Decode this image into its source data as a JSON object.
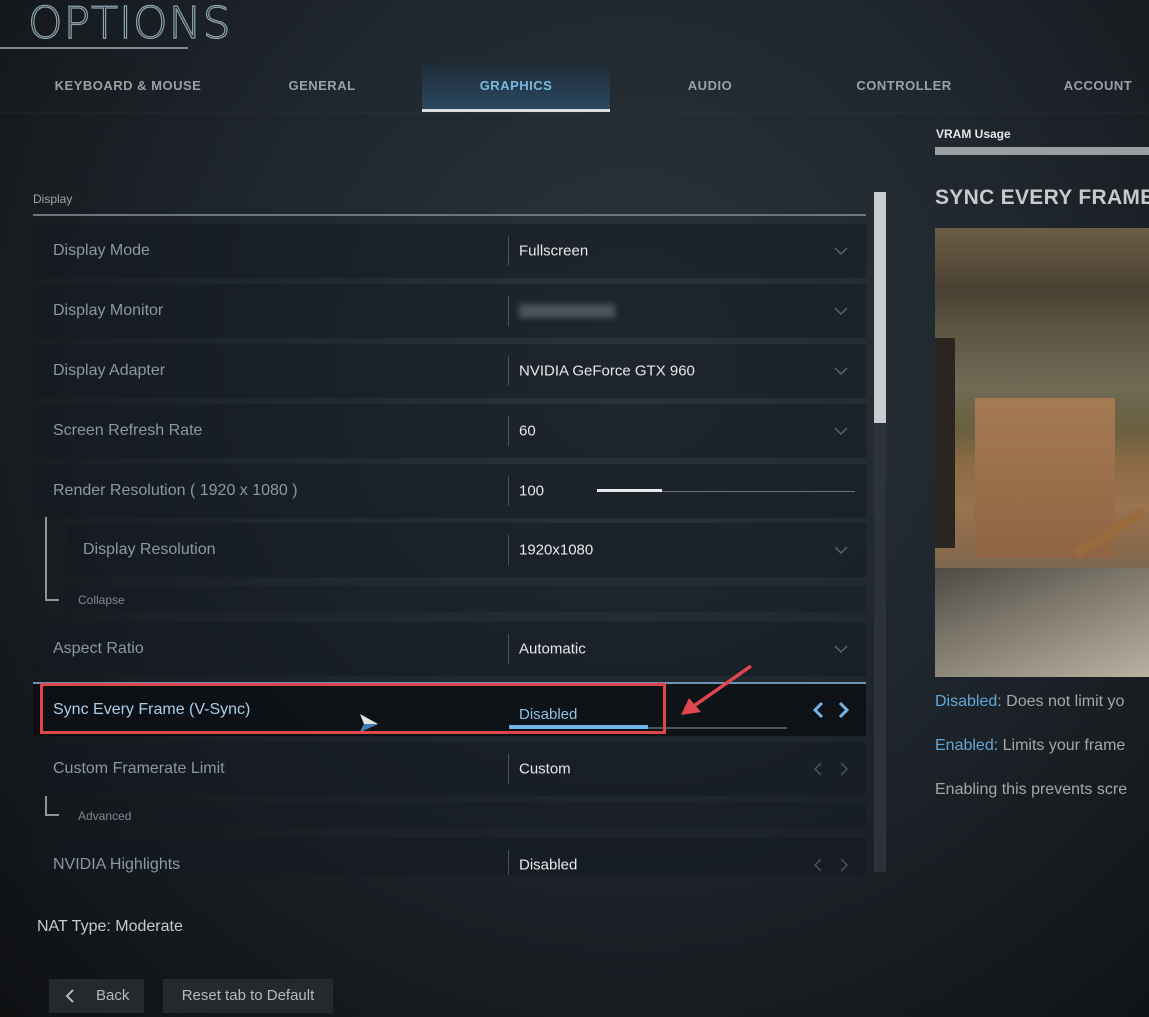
{
  "header": {
    "title": "OPTIONS"
  },
  "tabs": [
    {
      "label": "KEYBOARD & MOUSE",
      "active": false
    },
    {
      "label": "GENERAL",
      "active": false
    },
    {
      "label": "GRAPHICS",
      "active": true
    },
    {
      "label": "AUDIO",
      "active": false
    },
    {
      "label": "CONTROLLER",
      "active": false
    },
    {
      "label": "ACCOUNT",
      "active": false
    }
  ],
  "vram": {
    "label": "VRAM Usage",
    "usage_fraction": 1.0
  },
  "section": {
    "label": "Display"
  },
  "settings": {
    "display_mode": {
      "label": "Display Mode",
      "value": "Fullscreen",
      "control": "dropdown"
    },
    "display_monitor": {
      "label": "Display Monitor",
      "value": "",
      "control": "dropdown",
      "value_obscured": true
    },
    "display_adapter": {
      "label": "Display Adapter",
      "value": "NVIDIA GeForce GTX 960",
      "control": "dropdown"
    },
    "refresh_rate": {
      "label": "Screen Refresh Rate",
      "value": "60",
      "control": "dropdown"
    },
    "render_resolution": {
      "label": "Render Resolution ( 1920 x 1080 )",
      "value": "100",
      "control": "slider",
      "slider_fraction": 0.25
    },
    "display_resolution": {
      "label": "Display Resolution",
      "value": "1920x1080",
      "control": "dropdown"
    },
    "collapse_label": "Collapse",
    "aspect_ratio": {
      "label": "Aspect Ratio",
      "value": "Automatic",
      "control": "dropdown"
    },
    "vsync": {
      "label": "Sync Every Frame (V-Sync)",
      "value": "Disabled",
      "control": "selector",
      "selected": true,
      "option_fraction": 0.5
    },
    "framerate_limit": {
      "label": "Custom Framerate Limit",
      "value": "Custom",
      "control": "selector"
    },
    "advanced_label": "Advanced",
    "nvidia_highlights": {
      "label": "NVIDIA Highlights",
      "value": "Disabled",
      "control": "selector"
    }
  },
  "scroll": {
    "position_fraction": 0.0,
    "visible_fraction": 0.34
  },
  "detail": {
    "title": "SYNC EVERY FRAME",
    "descriptions": [
      {
        "key": "Disabled",
        "text": ": Does not limit yo"
      },
      {
        "key": "Enabled",
        "text": ": Limits your frame"
      },
      {
        "key": "",
        "text": "Enabling this prevents scre"
      }
    ]
  },
  "footer": {
    "nat_type": "NAT Type: Moderate",
    "back_label": "Back",
    "reset_label": "Reset tab to Default"
  },
  "colors": {
    "accent": "#6fb6e6",
    "annotation": "#e0474c"
  }
}
